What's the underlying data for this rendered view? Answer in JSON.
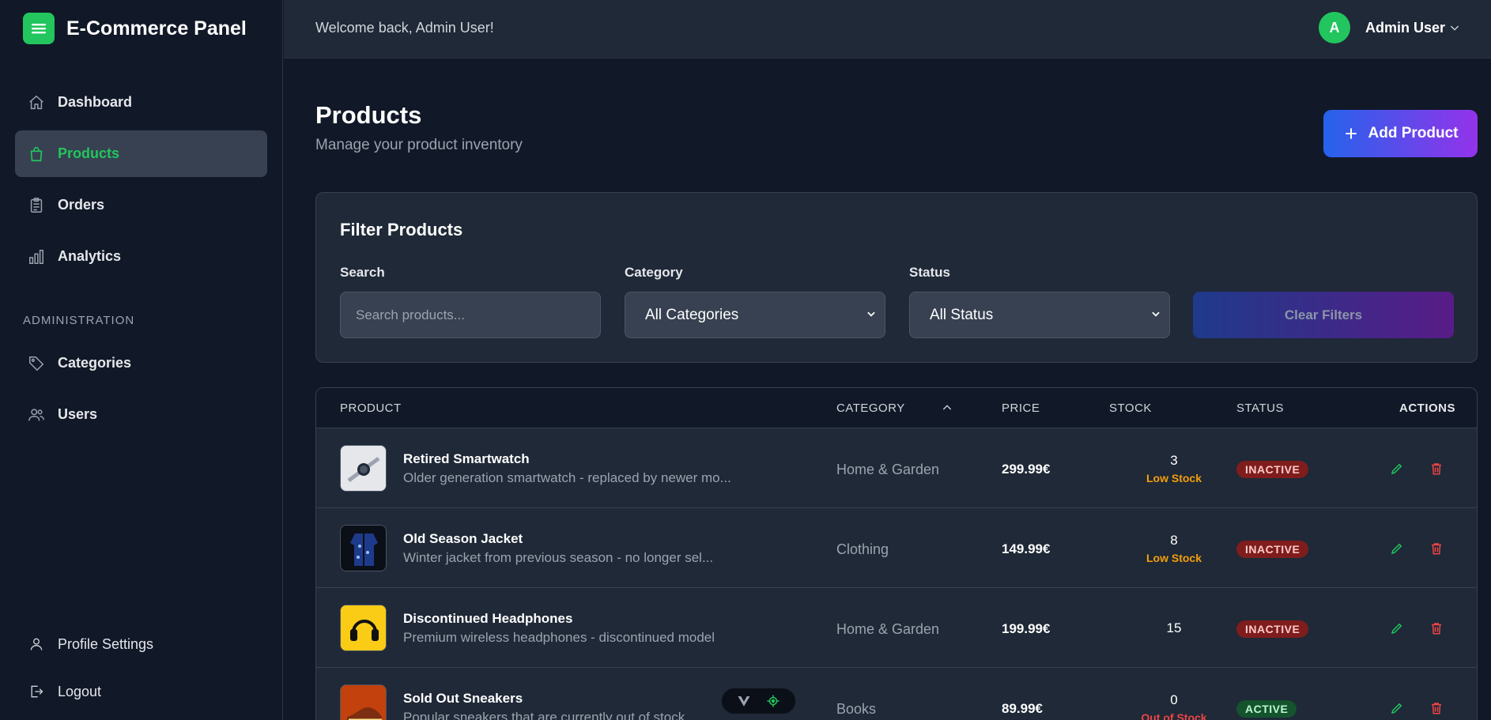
{
  "brand": {
    "title": "E-Commerce Panel",
    "icon": "menu-icon"
  },
  "sidebar": {
    "items": [
      {
        "label": "Dashboard",
        "icon": "home-icon"
      },
      {
        "label": "Products",
        "icon": "shopping-bag-icon",
        "active": true
      },
      {
        "label": "Orders",
        "icon": "clipboard-icon"
      },
      {
        "label": "Analytics",
        "icon": "bar-chart-icon"
      }
    ],
    "section_label": "ADMINISTRATION",
    "admin_items": [
      {
        "label": "Categories",
        "icon": "tag-icon"
      },
      {
        "label": "Users",
        "icon": "users-icon"
      }
    ],
    "bottom_items": [
      {
        "label": "Profile Settings",
        "icon": "user-icon"
      },
      {
        "label": "Logout",
        "icon": "logout-icon"
      }
    ]
  },
  "topbar": {
    "welcome": "Welcome back, Admin User!",
    "avatar_initial": "A",
    "user_name": "Admin User"
  },
  "main": {
    "title": "Products",
    "subtitle": "Manage your product inventory",
    "add_button": "Add Product"
  },
  "filters": {
    "title": "Filter Products",
    "search_label": "Search",
    "search_placeholder": "Search products...",
    "category_label": "Category",
    "category_value": "All Categories",
    "status_label": "Status",
    "status_value": "All Status",
    "clear_button": "Clear Filters"
  },
  "table": {
    "headers": {
      "product": "PRODUCT",
      "category": "CATEGORY",
      "price": "PRICE",
      "stock": "STOCK",
      "status": "STATUS",
      "actions": "ACTIONS"
    },
    "rows": [
      {
        "name": "Retired Smartwatch",
        "desc": "Older generation smartwatch - replaced by newer mo...",
        "category": "Home & Garden",
        "price": "299.99€",
        "stock": "3",
        "stock_note": "Low Stock",
        "status": "INACTIVE"
      },
      {
        "name": "Old Season Jacket",
        "desc": "Winter jacket from previous season - no longer sel...",
        "category": "Clothing",
        "price": "149.99€",
        "stock": "8",
        "stock_note": "Low Stock",
        "status": "INACTIVE"
      },
      {
        "name": "Discontinued Headphones",
        "desc": "Premium wireless headphones - discontinued model",
        "category": "Home & Garden",
        "price": "199.99€",
        "stock": "15",
        "stock_note": "",
        "status": "INACTIVE"
      },
      {
        "name": "Sold Out Sneakers",
        "desc": "Popular sneakers that are currently out of stock",
        "category": "Books",
        "price": "89.99€",
        "stock": "0",
        "stock_note": "Out of Stock",
        "status": "ACTIVE"
      }
    ]
  },
  "colors": {
    "accent": "#22c55e",
    "low_stock": "#f59e0b",
    "out_of_stock": "#ef4444",
    "edit": "#22c55e",
    "delete": "#ef4444"
  }
}
